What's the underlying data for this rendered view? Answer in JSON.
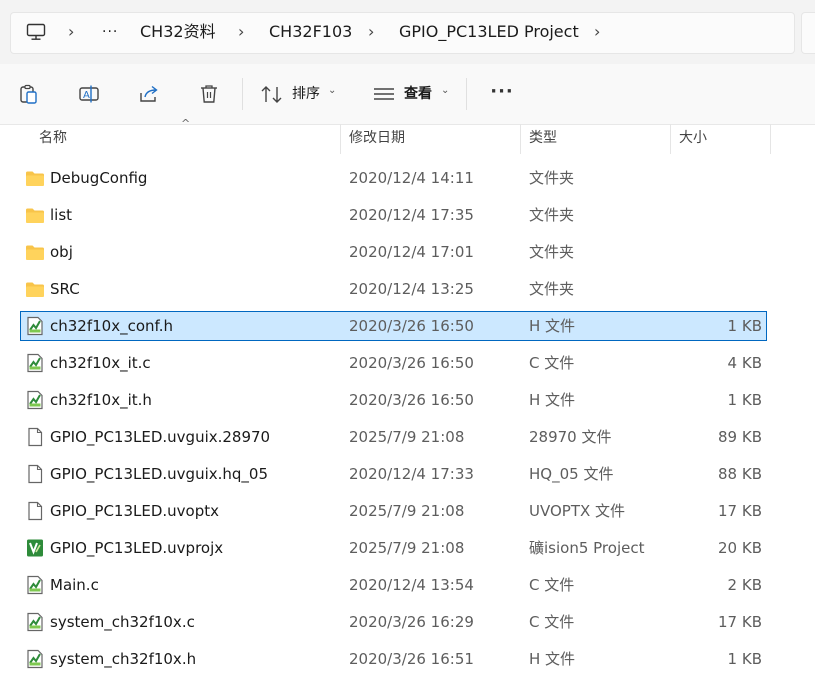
{
  "breadcrumb": {
    "ellipsis": "···",
    "items": [
      "CH32资料",
      "CH32F103",
      "GPIO_PC13LED Project"
    ]
  },
  "toolbar": {
    "sort_label": "排序",
    "view_label": "查看",
    "more_label": "···"
  },
  "columns": {
    "name": "名称",
    "date": "修改日期",
    "type": "类型",
    "size": "大小"
  },
  "files": [
    {
      "name": "DebugConfig",
      "date": "2020/12/4 14:11",
      "type": "文件夹",
      "size": "",
      "icon": "folder"
    },
    {
      "name": "list",
      "date": "2020/12/4 17:35",
      "type": "文件夹",
      "size": "",
      "icon": "folder"
    },
    {
      "name": "obj",
      "date": "2020/12/4 17:01",
      "type": "文件夹",
      "size": "",
      "icon": "folder"
    },
    {
      "name": "SRC",
      "date": "2020/12/4 13:25",
      "type": "文件夹",
      "size": "",
      "icon": "folder"
    },
    {
      "name": "ch32f10x_conf.h",
      "date": "2020/3/26 16:50",
      "type": "H 文件",
      "size": "1 KB",
      "icon": "code",
      "selected": true
    },
    {
      "name": "ch32f10x_it.c",
      "date": "2020/3/26 16:50",
      "type": "C 文件",
      "size": "4 KB",
      "icon": "code"
    },
    {
      "name": "ch32f10x_it.h",
      "date": "2020/3/26 16:50",
      "type": "H 文件",
      "size": "1 KB",
      "icon": "code"
    },
    {
      "name": "GPIO_PC13LED.uvguix.28970",
      "date": "2025/7/9 21:08",
      "type": "28970 文件",
      "size": "89 KB",
      "icon": "blank"
    },
    {
      "name": "GPIO_PC13LED.uvguix.hq_05",
      "date": "2020/12/4 17:33",
      "type": "HQ_05 文件",
      "size": "88 KB",
      "icon": "blank"
    },
    {
      "name": "GPIO_PC13LED.uvoptx",
      "date": "2025/7/9 21:08",
      "type": "UVOPTX 文件",
      "size": "17 KB",
      "icon": "blank"
    },
    {
      "name": "GPIO_PC13LED.uvprojx",
      "date": "2025/7/9 21:08",
      "type": "礦ision5 Project",
      "size": "20 KB",
      "icon": "keil"
    },
    {
      "name": "Main.c",
      "date": "2020/12/4 13:54",
      "type": "C 文件",
      "size": "2 KB",
      "icon": "code"
    },
    {
      "name": "system_ch32f10x.c",
      "date": "2020/3/26 16:29",
      "type": "C 文件",
      "size": "17 KB",
      "icon": "code"
    },
    {
      "name": "system_ch32f10x.h",
      "date": "2020/3/26 16:51",
      "type": "H 文件",
      "size": "1 KB",
      "icon": "code"
    }
  ],
  "colors": {
    "folder": "#f8c44a",
    "selection_bg": "#cce8ff",
    "selection_border": "#0067c0",
    "keil_green": "#2e8b3a"
  }
}
